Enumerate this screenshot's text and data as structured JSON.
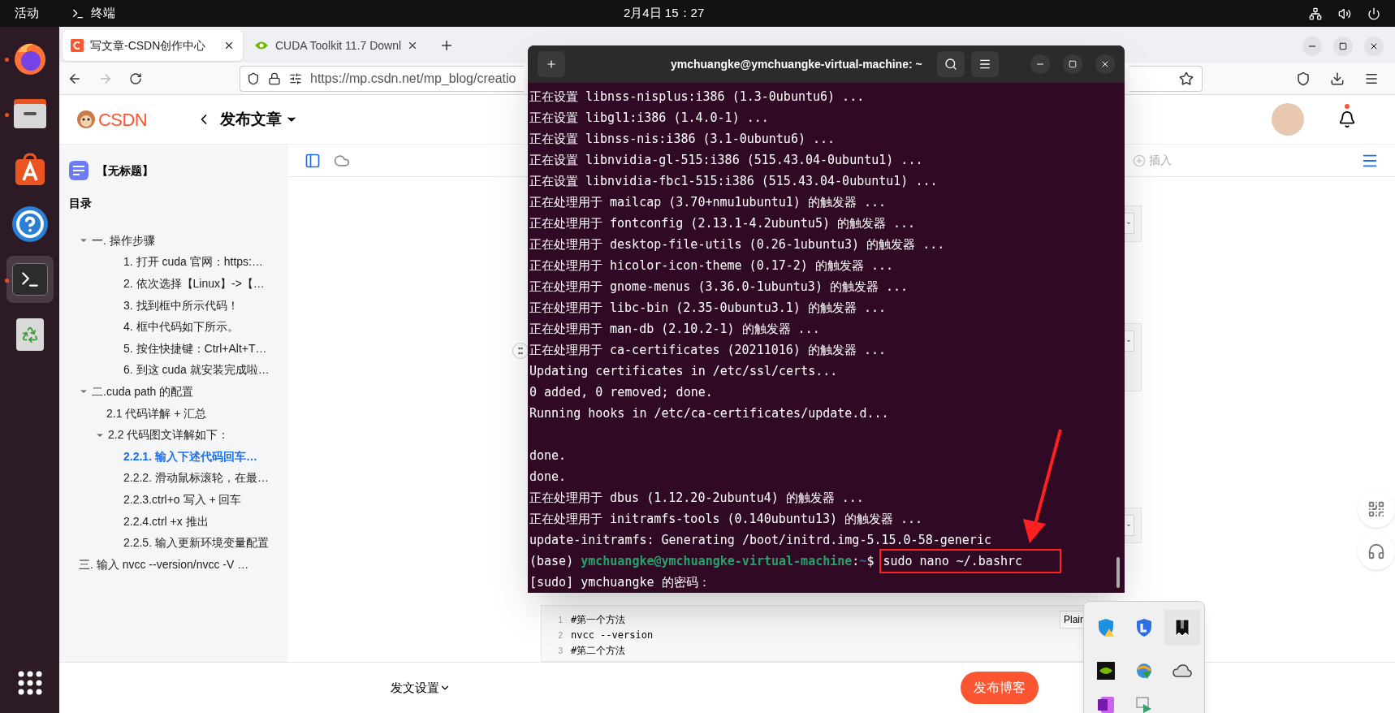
{
  "top_bar": {
    "activities": "活动",
    "app": "终端",
    "clock": "2月4日 15：27"
  },
  "dock": [
    {
      "kind": "firefox",
      "running": true,
      "selected": false
    },
    {
      "kind": "files",
      "running": true,
      "selected": false
    },
    {
      "kind": "software",
      "running": false,
      "selected": false
    },
    {
      "kind": "help",
      "running": false,
      "selected": false
    },
    {
      "kind": "terminal",
      "running": true,
      "selected": true
    },
    {
      "kind": "trash",
      "running": false,
      "selected": false
    }
  ],
  "browser": {
    "tabs": [
      {
        "kind": "csdn",
        "title": "写文章-CSDN创作中心",
        "selected": true
      },
      {
        "kind": "nvidia",
        "title": "CUDA Toolkit 11.7 Downl",
        "selected": false
      }
    ],
    "forward_enabled": false,
    "url": "https://mp.csdn.net/mp_blog/creatio"
  },
  "csdn": {
    "logo": "CSDN",
    "page_title": "发布文章",
    "notification": true
  },
  "toc": {
    "doc_title": "【无标题】",
    "heading": "目录",
    "items": [
      {
        "text": "一. 操作步骤",
        "expanded": true,
        "selected": false,
        "children": [
          {
            "text": "1. 打开 cuda 官网：https:…",
            "selected": false
          },
          {
            "text": "2. 依次选择【Linux】->【…",
            "selected": false
          },
          {
            "text": "3. 找到框中所示代码！",
            "selected": false
          },
          {
            "text": "4. 框中代码如下所示。",
            "selected": false
          },
          {
            "text": "5. 按住快捷键：Ctrl+Alt+T…",
            "selected": false
          },
          {
            "text": "6. 到这 cuda 就安装完成啦…",
            "selected": false
          }
        ]
      },
      {
        "text": "二.cuda path 的配置",
        "expanded": true,
        "selected": false,
        "children": [
          {
            "text": "2.1 代码详解 + 汇总",
            "selected": false
          },
          {
            "text": "2.2 代码图文详解如下：",
            "expanded": true,
            "selected": false,
            "children": [
              {
                "text": "2.2.1. 输入下述代码回车…",
                "selected": true
              },
              {
                "text": "2.2.2. 滑动鼠标滚轮，在最…",
                "selected": false
              },
              {
                "text": "2.2.3.ctrl+o 写入 + 回车",
                "selected": false
              },
              {
                "text": "2.2.4.ctrl +x 推出",
                "selected": false
              },
              {
                "text": "2.2.5. 输入更新环境变量配置",
                "selected": false
              }
            ]
          }
        ]
      },
      {
        "text": "三. 输入 nvcc --version/nvcc -V …",
        "selected": false
      }
    ]
  },
  "editor": {
    "insert": "插入",
    "code_block": {
      "language": "Plain",
      "lines": [
        {
          "number": "1",
          "code": "#第一个方法"
        },
        {
          "number": "2",
          "code": "nvcc --version"
        },
        {
          "number": "3",
          "code": "#第二个方法"
        }
      ]
    },
    "footer": {
      "settings": "发文设置",
      "publish": "发布博客"
    }
  },
  "terminal": {
    "title": "ymchuangke@ymchuangke-virtual-machine: ~",
    "lines": [
      {
        "kind": "output",
        "text": "正在设置 libnss-nisplus:i386 (1.3-0ubuntu6) ..."
      },
      {
        "kind": "output",
        "text": "正在设置 libgl1:i386 (1.4.0-1) ..."
      },
      {
        "kind": "output",
        "text": "正在设置 libnss-nis:i386 (3.1-0ubuntu6) ..."
      },
      {
        "kind": "output",
        "text": "正在设置 libnvidia-gl-515:i386 (515.43.04-0ubuntu1) ..."
      },
      {
        "kind": "output",
        "text": "正在设置 libnvidia-fbc1-515:i386 (515.43.04-0ubuntu1) ..."
      },
      {
        "kind": "output",
        "text": "正在处理用于 mailcap (3.70+nmu1ubuntu1) 的触发器 ..."
      },
      {
        "kind": "output",
        "text": "正在处理用于 fontconfig (2.13.1-4.2ubuntu5) 的触发器 ..."
      },
      {
        "kind": "output",
        "text": "正在处理用于 desktop-file-utils (0.26-1ubuntu3) 的触发器 ..."
      },
      {
        "kind": "output",
        "text": "正在处理用于 hicolor-icon-theme (0.17-2) 的触发器 ..."
      },
      {
        "kind": "output",
        "text": "正在处理用于 gnome-menus (3.36.0-1ubuntu3) 的触发器 ..."
      },
      {
        "kind": "output",
        "text": "正在处理用于 libc-bin (2.35-0ubuntu3.1) 的触发器 ..."
      },
      {
        "kind": "output",
        "text": "正在处理用于 man-db (2.10.2-1) 的触发器 ..."
      },
      {
        "kind": "output",
        "text": "正在处理用于 ca-certificates (20211016) 的触发器 ..."
      },
      {
        "kind": "output",
        "text": "Updating certificates in /etc/ssl/certs..."
      },
      {
        "kind": "output",
        "text": "0 added, 0 removed; done."
      },
      {
        "kind": "output",
        "text": "Running hooks in /etc/ca-certificates/update.d..."
      },
      {
        "kind": "blank"
      },
      {
        "kind": "output",
        "text": "done."
      },
      {
        "kind": "output",
        "text": "done."
      },
      {
        "kind": "output",
        "text": "正在处理用于 dbus (1.12.20-2ubuntu4) 的触发器 ..."
      },
      {
        "kind": "output",
        "text": "正在处理用于 initramfs-tools (0.140ubuntu13) 的触发器 ..."
      },
      {
        "kind": "output",
        "text": "update-initramfs: Generating /boot/initrd.img-5.15.0-58-generic"
      },
      {
        "kind": "prompt",
        "env": "(base)",
        "user_host": "ymchuangke@ymchuangke-virtual-machine",
        "separator": ":",
        "path": "~",
        "symbol": "$",
        "command": "sudo nano ~/.bashrc",
        "highlighted": true
      },
      {
        "kind": "output",
        "text": "[sudo] ymchuangke 的密码："
      }
    ]
  }
}
